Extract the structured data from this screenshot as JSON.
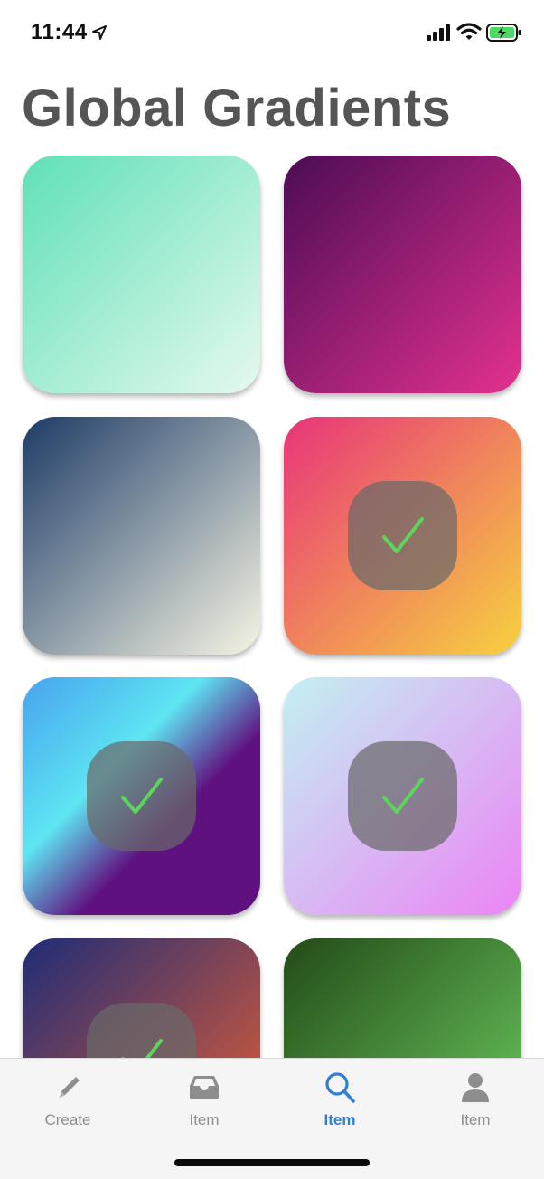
{
  "status_bar": {
    "time": "11:44",
    "icons": [
      "location-arrow-icon",
      "cellular-signal-icon",
      "wifi-icon",
      "battery-charging-icon"
    ],
    "battery_color": "#4cd964"
  },
  "page": {
    "title": "Global Gradients"
  },
  "gradients": [
    {
      "from": "#5fe0b8",
      "to": "#e6f9ee",
      "selected": false
    },
    {
      "from": "#4b0c55",
      "to": "#e3318f",
      "selected": false
    },
    {
      "from": "#1d3b66",
      "to": "#f6f5e4",
      "selected": false
    },
    {
      "from": "#e8347a",
      "to": "#f7d23f",
      "selected": true
    },
    {
      "from": "#47a3ee",
      "mid": "#5ee5f2",
      "to": "#5f1180",
      "selected": true
    },
    {
      "from": "#c3f0f2",
      "to": "#ec84f5",
      "selected": true
    },
    {
      "from": "#1f2c77",
      "to": "#ec6031",
      "selected": true
    },
    {
      "from": "#234b17",
      "to": "#6fd063",
      "selected": false
    }
  ],
  "check_color": "#5cd55a",
  "tab_bar": {
    "tabs": [
      {
        "label": "Create",
        "icon": "pencil-icon",
        "active": false
      },
      {
        "label": "Item",
        "icon": "inbox-tray-icon",
        "active": false
      },
      {
        "label": "Item",
        "icon": "search-icon",
        "active": true
      },
      {
        "label": "Item",
        "icon": "person-icon",
        "active": false
      }
    ],
    "active_color": "#2f7fd8",
    "inactive_color": "#8e8e8e"
  }
}
